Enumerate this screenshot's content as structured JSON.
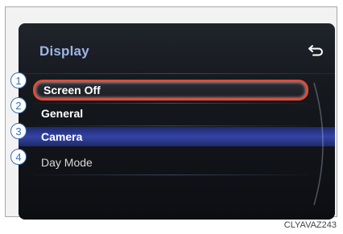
{
  "display": {
    "title": "Display",
    "back_icon": "back-arrow-icon",
    "menu_items": [
      {
        "number": "1",
        "label": "Screen Off",
        "state": "selected"
      },
      {
        "number": "2",
        "label": "General",
        "state": "normal"
      },
      {
        "number": "3",
        "label": "Camera",
        "state": "highlighted"
      },
      {
        "number": "4",
        "label": "Day Mode",
        "state": "normal"
      }
    ]
  },
  "figure_code": "CLYAVAZ243",
  "colors": {
    "title": "#9fb4e8",
    "selection_border": "#e24b36",
    "highlight": "#3443a6",
    "callout": "#3a6fb7"
  }
}
